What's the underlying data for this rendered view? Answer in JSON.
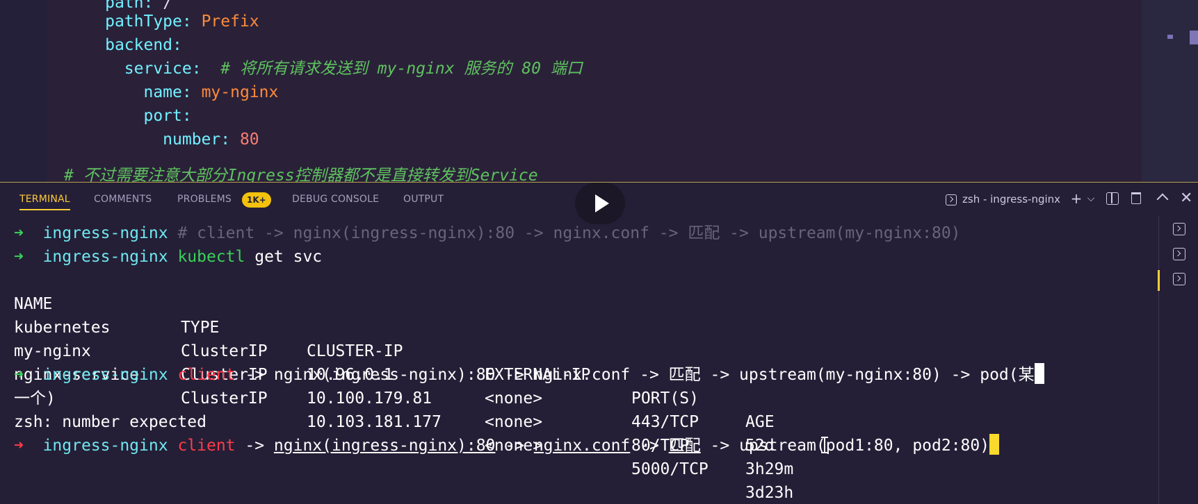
{
  "editor": {
    "lines": [
      {
        "indent": "      ",
        "key": "path:",
        "value": " /"
      },
      {
        "indent": "      ",
        "key": "pathType:",
        "value": " Prefix"
      },
      {
        "indent": "      ",
        "key": "backend:",
        "value": ""
      },
      {
        "indent": "        ",
        "key": "service:",
        "comment": "  # 将所有请求发送到 my-nginx 服务的 80 端口"
      },
      {
        "indent": "          ",
        "key": "name:",
        "value": " my-nginx"
      },
      {
        "indent": "          ",
        "key": "port:",
        "value": ""
      },
      {
        "indent": "            ",
        "key": "number:",
        "number": " 80"
      }
    ],
    "bottom_comment": "# 不过需要注意大部分Ingress控制器都不是直接转发到Service"
  },
  "panel": {
    "tabs": {
      "terminal": "TERMINAL",
      "comments": "COMMENTS",
      "problems": "PROBLEMS",
      "problems_badge": "1K+",
      "debug_console": "DEBUG CONSOLE",
      "output": "OUTPUT"
    },
    "terminal_title": "zsh - ingress-nginx",
    "tools": {
      "add": "+",
      "dropdown": "⌵",
      "close": "✕"
    }
  },
  "terminal": {
    "prompt_arrow": "➜",
    "cwd": "ingress-nginx",
    "line1_comment": "# client -> nginx(ingress-nginx):80 -> nginx.conf -> 匹配 -> upstream(my-nginx:80)",
    "line2_cmd": "kubectl",
    "line2_args": " get svc",
    "table_headers": [
      "NAME",
      "TYPE",
      "CLUSTER-IP",
      "EXTERNAL-IP",
      "PORT(S)",
      "AGE"
    ],
    "table_rows": [
      [
        "kubernetes",
        "ClusterIP",
        "10.96.0.1",
        "<none>",
        "443/TCP",
        "52d"
      ],
      [
        "my-nginx",
        "ClusterIP",
        "10.100.179.81",
        "<none>",
        "80/TCP",
        "3h29m"
      ],
      [
        "nginx-service",
        "ClusterIP",
        "10.103.181.177",
        "<none>",
        "5000/TCP",
        "3d23h"
      ]
    ],
    "line7_cmd": "client",
    "line7_args": " -> nginx(ingress-nginx):80 -> nginx.conf -> 匹配 -> upstream(my-nginx:80) -> pod(某",
    "line8": "一个)",
    "line9": "zsh: number expected",
    "line10_cmd": "client",
    "line10_seg1": " -> ",
    "line10_u1": "nginx(ingress-nginx):80",
    "line10_seg2": " -> ",
    "line10_u2": "nginx.conf",
    "line10_seg3": " -> ",
    "line10_u3": "匹配",
    "line10_seg4": " -> upstream(pod1:80, pod2:80)"
  },
  "colors": {
    "accent": "#ffcc3b",
    "prompt_ok": "#3ad05a",
    "prompt_error": "#ff3b4a",
    "cwd": "#6fe7f0"
  }
}
